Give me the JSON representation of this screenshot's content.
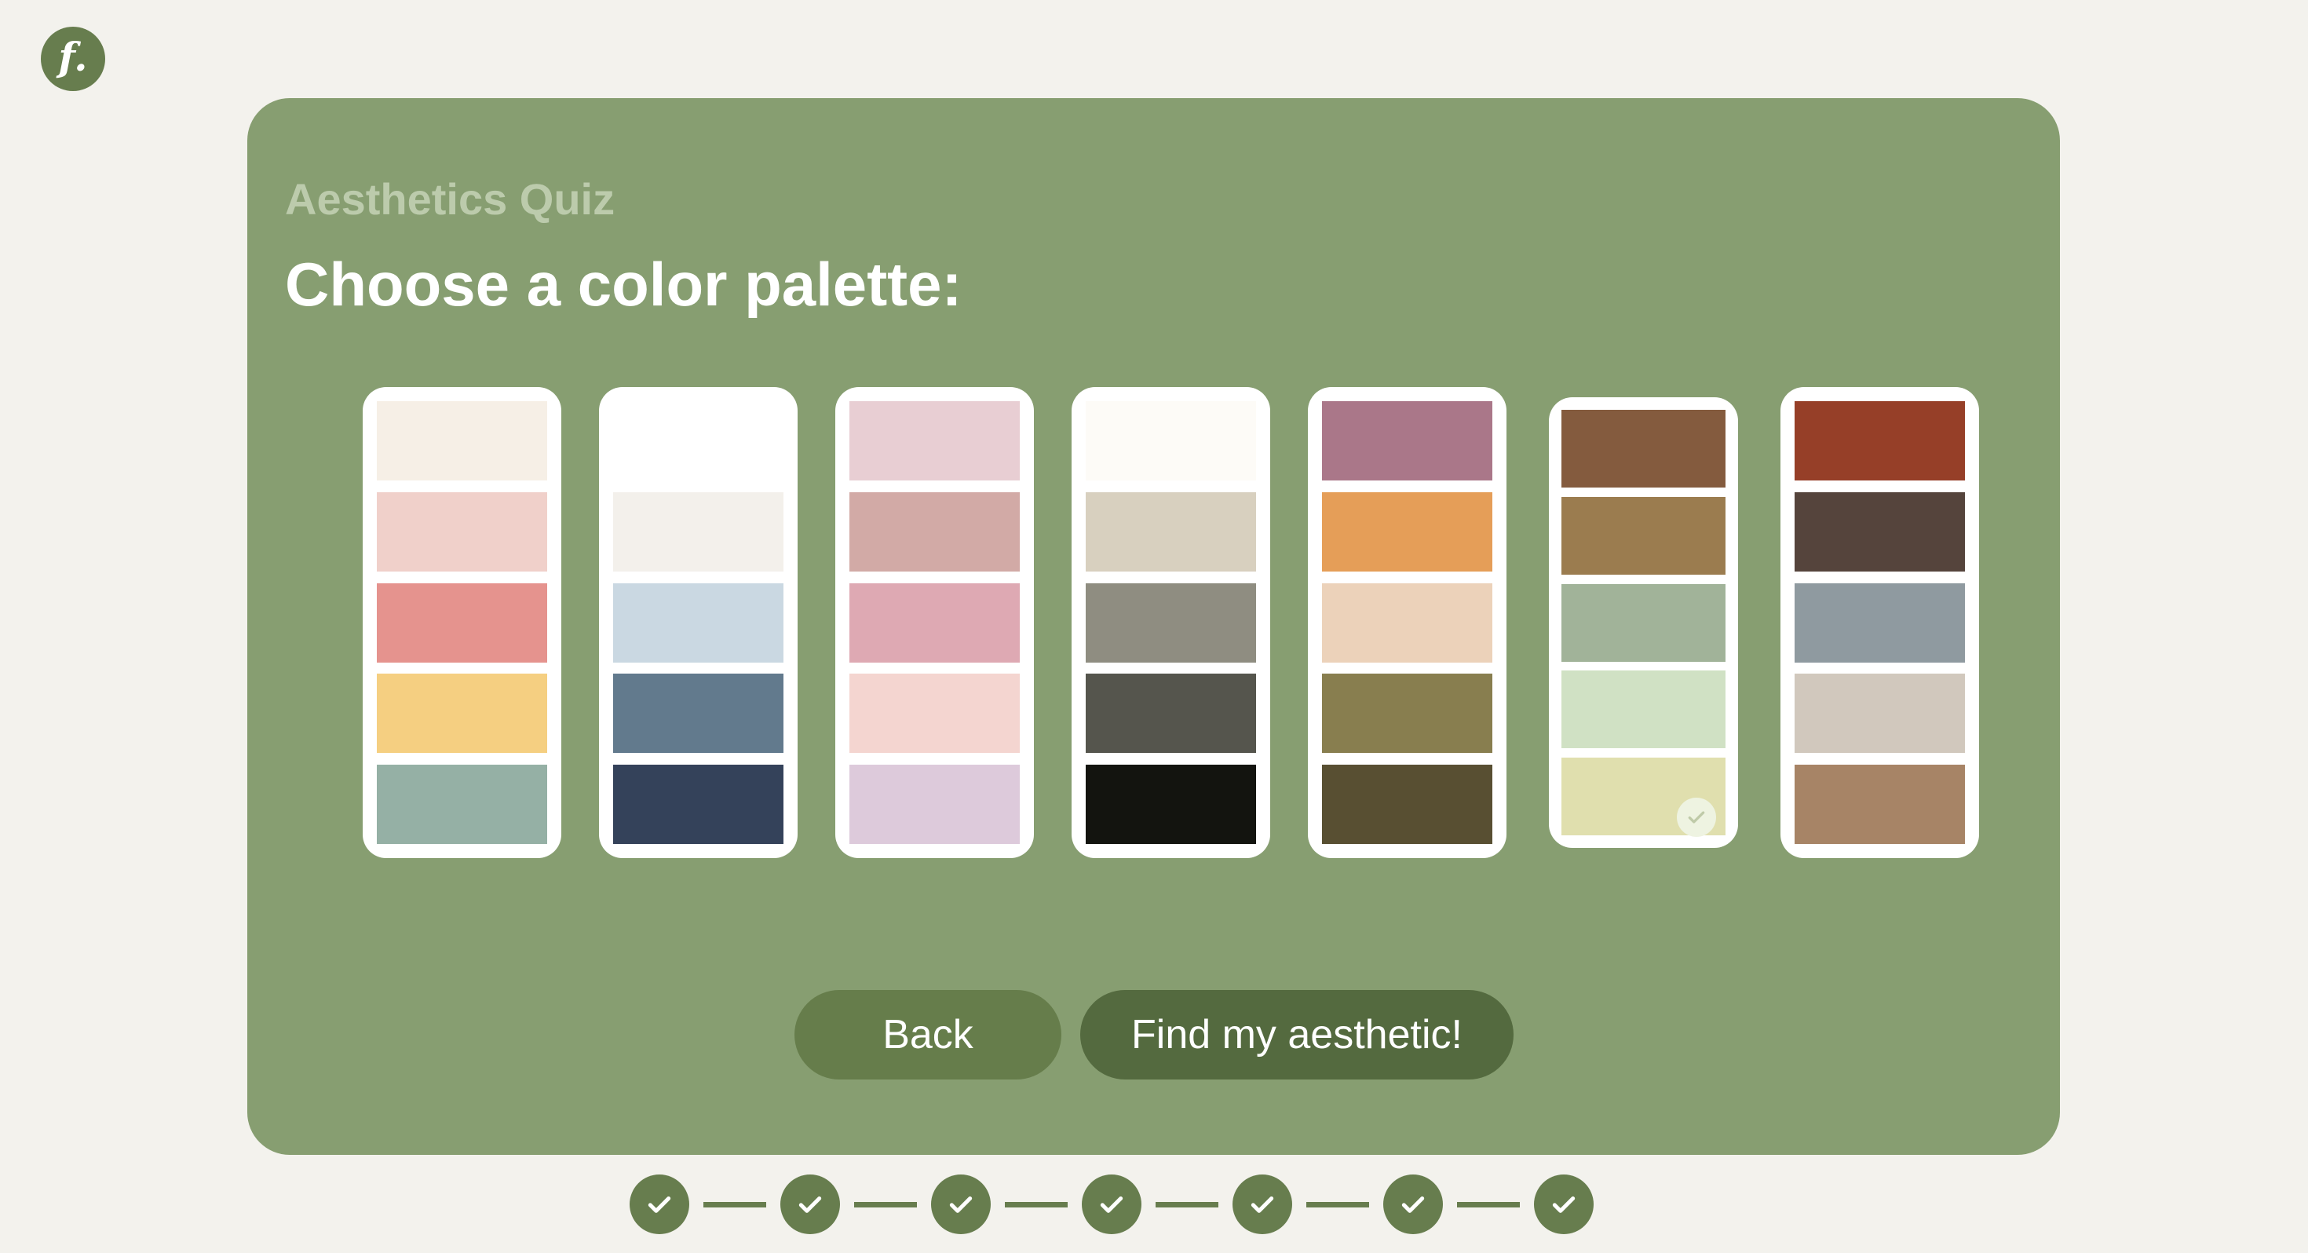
{
  "header": {
    "logo_text": "f."
  },
  "quiz": {
    "label": "Aesthetics Quiz",
    "question": "Choose a color palette:"
  },
  "palettes": [
    {
      "selected": false,
      "colors": [
        "#f6efe6",
        "#f0d0ca",
        "#e5938e",
        "#f5cf81",
        "#95b0a5"
      ]
    },
    {
      "selected": false,
      "colors": [
        "#ffffff",
        "#f3f0eb",
        "#cad8e2",
        "#627a8d",
        "#34425a"
      ]
    },
    {
      "selected": false,
      "colors": [
        "#e8ced3",
        "#d2aaa6",
        "#dea9b3",
        "#f4d5d0",
        "#ddcadb"
      ]
    },
    {
      "selected": false,
      "colors": [
        "#fdfbf7",
        "#d8d0bf",
        "#8f8d81",
        "#55554d",
        "#13140f"
      ]
    },
    {
      "selected": false,
      "colors": [
        "#aa7789",
        "#e59e58",
        "#ecd2ba",
        "#887e4f",
        "#584f32"
      ]
    },
    {
      "selected": true,
      "colors": [
        "#845b3e",
        "#9b7c4f",
        "#a1b399",
        "#d0e1c4",
        "#e0dfae"
      ]
    },
    {
      "selected": false,
      "colors": [
        "#963f28",
        "#55443c",
        "#8f9aa0",
        "#d1c8bd",
        "#a78466"
      ]
    }
  ],
  "buttons": {
    "back_label": "Back",
    "find_label": "Find my aesthetic!"
  },
  "progress": {
    "steps_completed": 7,
    "steps_total": 7
  },
  "colors": {
    "background": "#f3f2ed",
    "card": "#879e71",
    "accent_dark": "#546a3f",
    "accent": "#677d4e"
  }
}
